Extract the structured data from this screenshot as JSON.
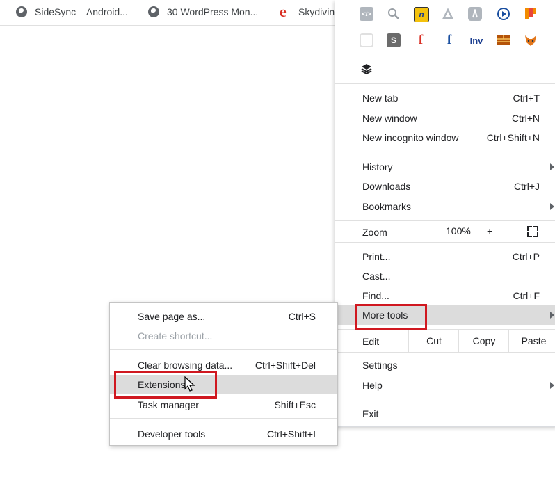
{
  "bookmarks": [
    {
      "label": "SideSync – Android...",
      "icon": "globe-icon"
    },
    {
      "label": "30 WordPress Mon...",
      "icon": "globe-icon"
    },
    {
      "label": "Skydivin",
      "icon": "e-logo-icon"
    }
  ],
  "extensions_row1": [
    "code-icon",
    "inspect-icon",
    "notes-icon",
    "pdf-icon",
    "leaf-icon",
    "play-icon",
    "grid-icon"
  ],
  "extensions_row2": [
    "pocket-icon",
    "s-icon",
    "f-red-icon",
    "f-blue-icon",
    "inv-icon",
    "brick-icon",
    "fox-icon"
  ],
  "ext_labels": {
    "s": "S",
    "f": "f",
    "inv": "Inv",
    "n": "n"
  },
  "menu": {
    "new_tab": {
      "label": "New tab",
      "shortcut": "Ctrl+T"
    },
    "new_window": {
      "label": "New window",
      "shortcut": "Ctrl+N"
    },
    "new_incognito": {
      "label": "New incognito window",
      "shortcut": "Ctrl+Shift+N"
    },
    "history": {
      "label": "History"
    },
    "downloads": {
      "label": "Downloads",
      "shortcut": "Ctrl+J"
    },
    "bookmarks": {
      "label": "Bookmarks"
    },
    "zoom": {
      "label": "Zoom",
      "minus": "–",
      "value": "100%",
      "plus": "+"
    },
    "print": {
      "label": "Print...",
      "shortcut": "Ctrl+P"
    },
    "cast": {
      "label": "Cast..."
    },
    "find": {
      "label": "Find...",
      "shortcut": "Ctrl+F"
    },
    "more_tools": {
      "label": "More tools"
    },
    "edit": {
      "label": "Edit",
      "cut": "Cut",
      "copy": "Copy",
      "paste": "Paste"
    },
    "settings": {
      "label": "Settings"
    },
    "help": {
      "label": "Help"
    },
    "exit": {
      "label": "Exit"
    }
  },
  "submenu": {
    "save_page": {
      "label": "Save page as...",
      "shortcut": "Ctrl+S"
    },
    "create_shortcut": {
      "label": "Create shortcut..."
    },
    "clear_browsing": {
      "label": "Clear browsing data...",
      "shortcut": "Ctrl+Shift+Del"
    },
    "extensions": {
      "label": "Extensions"
    },
    "task_manager": {
      "label": "Task manager",
      "shortcut": "Shift+Esc"
    },
    "developer_tools": {
      "label": "Developer tools",
      "shortcut": "Ctrl+Shift+I"
    }
  },
  "colors": {
    "highlight": "#dcdcdc",
    "annotation_red": "#d01820"
  }
}
